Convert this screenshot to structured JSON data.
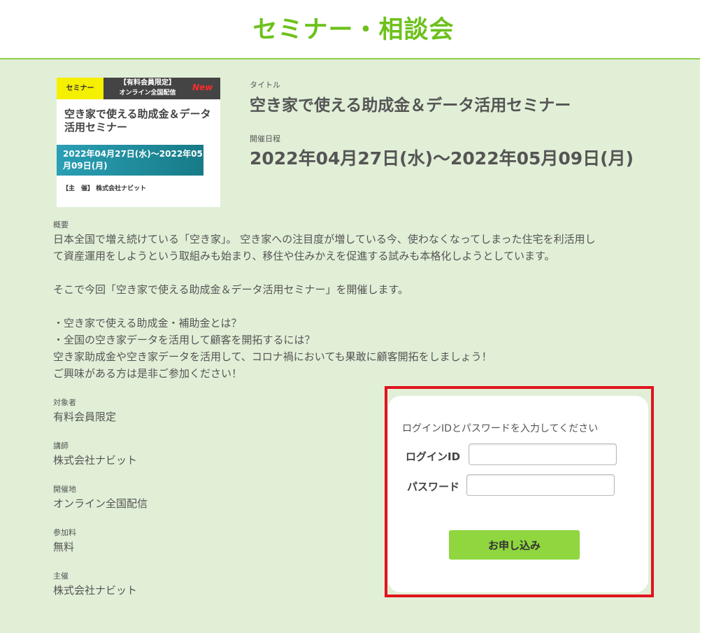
{
  "header": {
    "title": "セミナー・相談会"
  },
  "banner": {
    "tag": "セミナー",
    "limited_line1": "【有料会員限定】",
    "limited_line2": "オンライン全国配信",
    "new_badge": "New",
    "title": "空き家で使える助成金＆データ活用セミナー",
    "date": "2022年04月27日(水)～2022年05月09日(月)",
    "host": "【主　催】 株式会社ナビット"
  },
  "seminar": {
    "title_label": "タイトル",
    "title": "空き家で使える助成金＆データ活用セミナー",
    "date_label": "開催日程",
    "date": "2022年04月27日(水)～2022年05月09日(月)"
  },
  "summary": {
    "label": "概要",
    "lines": [
      "日本全国で増え続けている「空き家」。 空き家への注目度が増している今、使わなくなってしまった住宅を利活用し",
      "て資産運用をしようという取組みも始まり、移住や住みかえを促進する試みも本格化しようとしています。",
      "",
      "そこで今回「空き家で使える助成金＆データ活用セミナー」を開催します。",
      "",
      "・空き家で使える助成金・補助金とは？",
      "・全国の空き家データを活用して顧客を開拓するには？",
      "空き家助成金や空き家データを活用して、コロナ禍においても果敢に顧客開拓をしましょう！",
      "ご興味がある方は是非ご参加ください！"
    ]
  },
  "info": [
    {
      "label": "対象者",
      "value": "有料会員限定"
    },
    {
      "label": "講師",
      "value": "株式会社ナビット"
    },
    {
      "label": "開催地",
      "value": "オンライン全国配信"
    },
    {
      "label": "参加料",
      "value": "無料"
    },
    {
      "label": "主催",
      "value": "株式会社ナビット"
    }
  ],
  "login": {
    "instruction": "ログインIDとパスワードを入力してください",
    "id_label": "ログインID",
    "id_value": "",
    "password_label": "パスワード",
    "password_value": "",
    "submit_label": "お申し込み"
  },
  "colors": {
    "accent_green": "#6cc11b",
    "content_bg": "#e1efd7",
    "button_green": "#8fd63f",
    "highlight_red": "#e0141e"
  }
}
